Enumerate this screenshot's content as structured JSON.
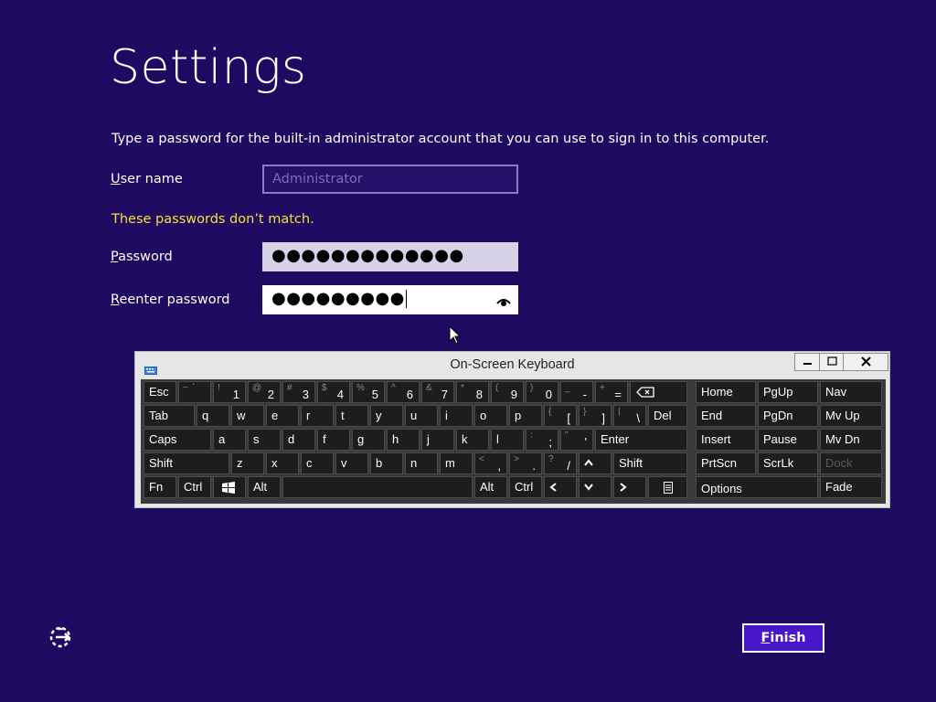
{
  "page": {
    "title": "Settings",
    "description": "Type a password for the built-in administrator account that you can use to sign in to this computer.",
    "error": "These passwords don’t match."
  },
  "form": {
    "username_label_accel": "U",
    "username_label_rest": "ser name",
    "username_placeholder": "Administrator",
    "password_label_accel": "P",
    "password_label_rest": "assword",
    "password_value": "●●●●●●●●●●●●●",
    "reenter_label_accel": "R",
    "reenter_label_rest": "eenter password",
    "reenter_value": "●●●●●●●●●"
  },
  "osk": {
    "title": "On-Screen Keyboard",
    "rows": [
      [
        "Esc",
        "~ `",
        "! 1",
        "@ 2",
        "# 3",
        "$ 4",
        "% 5",
        "^ 6",
        "& 7",
        "* 8",
        "( 9",
        ") 0",
        "_ -",
        "+ =",
        "⌫"
      ],
      [
        "Tab",
        "q",
        "w",
        "e",
        "r",
        "t",
        "y",
        "u",
        "i",
        "o",
        "p",
        "{ [",
        "} ]",
        "| \\",
        "Del"
      ],
      [
        "Caps",
        "a",
        "s",
        "d",
        "f",
        "g",
        "h",
        "j",
        "k",
        "l",
        ": ;",
        "\" '",
        "Enter"
      ],
      [
        "Shift",
        "z",
        "x",
        "c",
        "v",
        "b",
        "n",
        "m",
        "< ,",
        "> .",
        "? /",
        "▲",
        "Shift"
      ],
      [
        "Fn",
        "Ctrl",
        "⊞",
        "Alt",
        "",
        "Alt",
        "Ctrl",
        "◀",
        "▼",
        "▶",
        "▤"
      ]
    ],
    "nav_keys": {
      "home": "Home",
      "pgup": "PgUp",
      "nav": "Nav",
      "end": "End",
      "pgdn": "PgDn",
      "mvup": "Mv Up",
      "insert": "Insert",
      "pause": "Pause",
      "mvdn": "Mv Dn",
      "prtscn": "PrtScn",
      "scrlk": "ScrLk",
      "dock": "Dock",
      "options": "Options",
      "fade": "Fade"
    },
    "top_row_symbols": [
      "~",
      "!",
      "@",
      "#",
      "$",
      "%",
      "^",
      "&",
      "*",
      "(",
      ")",
      "_",
      "+"
    ],
    "top_row_main": [
      "`",
      "1",
      "2",
      "3",
      "4",
      "5",
      "6",
      "7",
      "8",
      "9",
      "0",
      "-",
      "="
    ],
    "bracket_symbols": [
      "{",
      "}",
      "|"
    ],
    "bracket_main": [
      "[",
      "]",
      "\\"
    ],
    "row3_symbols": [
      ":",
      "\""
    ],
    "row3_main": [
      ";",
      "'"
    ],
    "row4_symbols": [
      "<",
      ">",
      "?"
    ],
    "row4_main": [
      ",",
      ".",
      "/"
    ]
  },
  "footer": {
    "finish_accel": "F",
    "finish_rest": "inish"
  },
  "colors": {
    "background": "#1f0a62",
    "error_text": "#f3e33a",
    "finish_button": "#4816c9"
  }
}
